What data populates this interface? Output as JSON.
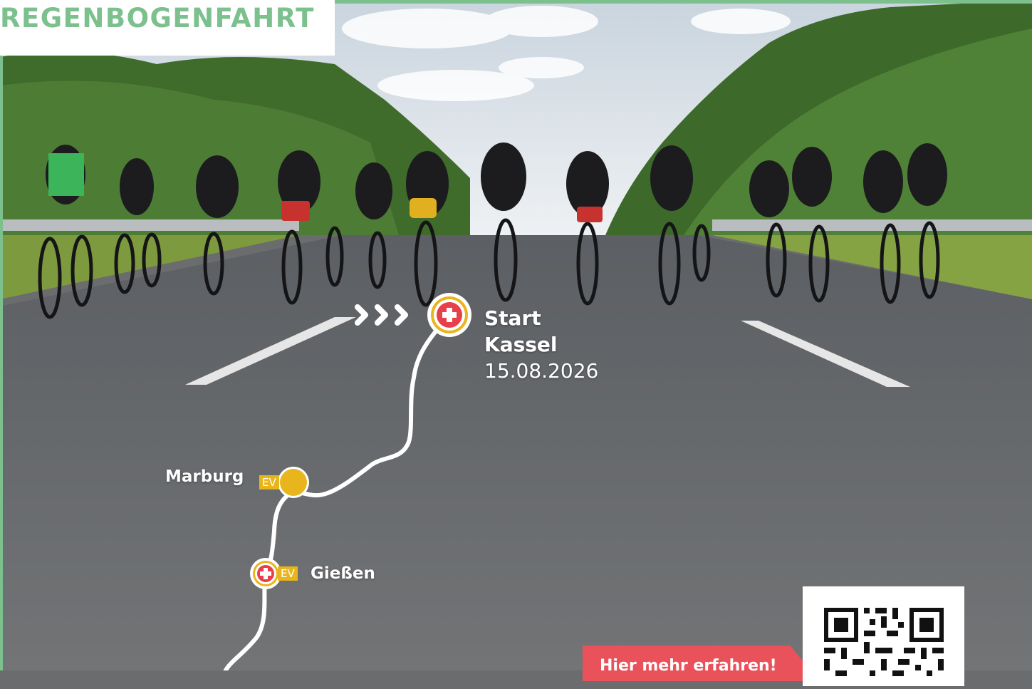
{
  "brand": {
    "title": "REGENBOGENFAHRT"
  },
  "route": {
    "start": {
      "label": "Start",
      "city": "Kassel",
      "date": "15.08.2026"
    },
    "stops": [
      {
        "name": "Marburg",
        "tag": "EV"
      },
      {
        "name": "Gießen",
        "tag": "EV"
      }
    ]
  },
  "cta": {
    "label": "Hier mehr erfahren!"
  },
  "colors": {
    "brand_green": "#7cc08e",
    "route_line": "#ffffff",
    "marker_red": "#e8404a",
    "marker_yellow": "#e9b51c",
    "cta_red": "#e9525a"
  },
  "icons": {
    "start_marker": "red-cross-icon",
    "start_arrows": "chevron-right-icon",
    "giessen_marker": "red-cross-icon",
    "marburg_marker": "yellow-dot-icon",
    "qr": "qr-code-icon"
  }
}
